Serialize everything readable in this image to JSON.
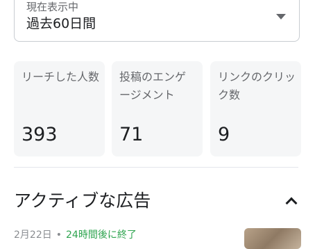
{
  "filter": {
    "label": "現在表示中",
    "value": "過去60日間"
  },
  "metrics": [
    {
      "label": "リーチした人数",
      "value": "393"
    },
    {
      "label": "投稿のエンゲージメント",
      "value": "71"
    },
    {
      "label": "リンクのクリック数",
      "value": "9"
    }
  ],
  "active_ads": {
    "title": "アクティブな広告",
    "first_ad": {
      "date": "2月22日",
      "status": "24時間後に終了"
    }
  },
  "colors": {
    "status_green": "#2ea44f",
    "card_bg": "#f5f6f7"
  },
  "icons": {
    "dropdown": "caret-down-icon",
    "collapse": "chevron-up-icon"
  }
}
